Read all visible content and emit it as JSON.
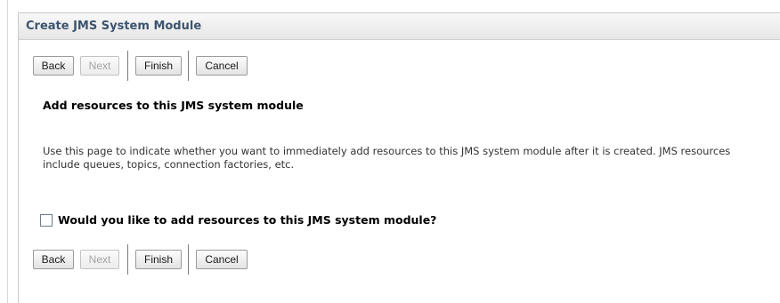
{
  "title": "Create JMS System Module",
  "buttons_top": {
    "back": "Back",
    "next": "Next",
    "finish": "Finish",
    "cancel": "Cancel"
  },
  "buttons_bottom": {
    "back": "Back",
    "next": "Next",
    "finish": "Finish",
    "cancel": "Cancel"
  },
  "section": {
    "heading": "Add resources to this JMS system module",
    "description": "Use this page to indicate whether you want to immediately add resources to this JMS system module after it is created. JMS resources include queues, topics, connection factories, etc."
  },
  "checkbox": {
    "label": "Would you like to add resources to this JMS system module?",
    "checked": false
  }
}
